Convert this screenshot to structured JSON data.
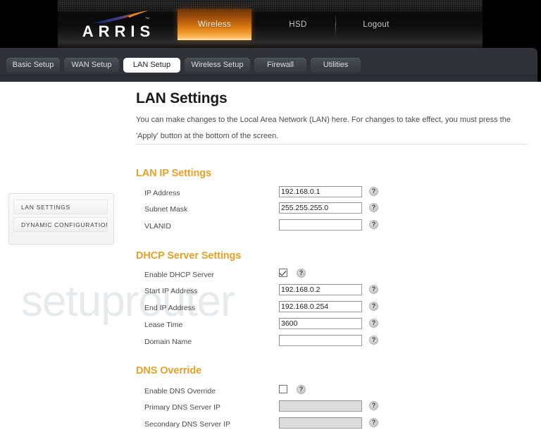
{
  "brand": {
    "logo_text": "ARRIS",
    "logo_icon": "arris-swoosh-logo"
  },
  "topnav": {
    "items": [
      {
        "label": "Wireless",
        "active": true
      },
      {
        "label": "HSD",
        "active": false
      },
      {
        "label": "Logout",
        "active": false
      }
    ]
  },
  "tabs": [
    {
      "label": "Basic Setup",
      "active": false
    },
    {
      "label": "WAN Setup",
      "active": false
    },
    {
      "label": "LAN Setup",
      "active": true
    },
    {
      "label": "Wireless Setup",
      "active": false
    },
    {
      "label": "Firewall",
      "active": false
    },
    {
      "label": "Utilities",
      "active": false
    }
  ],
  "sidebar": {
    "items": [
      {
        "label": "LAN SETTINGS"
      },
      {
        "label": "DYNAMIC CONFIGURATION"
      }
    ]
  },
  "page": {
    "title": "LAN Settings",
    "description": "You can make changes to the Local Area Network (LAN) here. For changes to take effect, you must press the 'Apply' button at the bottom of the screen."
  },
  "watermark": {
    "text": "setuprouter"
  },
  "sections": {
    "lan_ip": {
      "title": "LAN IP Settings",
      "fields": [
        {
          "label": "IP Address",
          "value": "192.168.0.1",
          "help": "?"
        },
        {
          "label": "Subnet Mask",
          "value": "255.255.255.0",
          "help": "?"
        },
        {
          "label": "VLANID",
          "value": "",
          "help": "?"
        }
      ]
    },
    "dhcp": {
      "title": "DHCP Server Settings",
      "checkbox": {
        "label": "Enable DHCP Server",
        "checked": true,
        "help": "?"
      },
      "fields": [
        {
          "label": "Start IP Address",
          "value": "192.168.0.2",
          "help": "?"
        },
        {
          "label": "End IP Address",
          "value": "192.168.0.254",
          "help": "?"
        },
        {
          "label": "Lease Time",
          "value": "3600",
          "help": "?"
        },
        {
          "label": "Domain Name",
          "value": "",
          "help": "?"
        }
      ]
    },
    "dns": {
      "title": "DNS Override",
      "checkbox": {
        "label": "Enable DNS Override",
        "checked": false,
        "help": "?"
      },
      "fields": [
        {
          "label": "Primary DNS Server IP",
          "value": "",
          "disabled": true,
          "help": "?"
        },
        {
          "label": "Secondary DNS Server IP",
          "value": "",
          "disabled": true,
          "help": "?"
        }
      ]
    }
  },
  "colors": {
    "accent_orange": "#e8a128",
    "header_black": "#0d0d0d",
    "tabbar_gray": "#2f3237",
    "active_tab_bg": "#ffffff"
  }
}
